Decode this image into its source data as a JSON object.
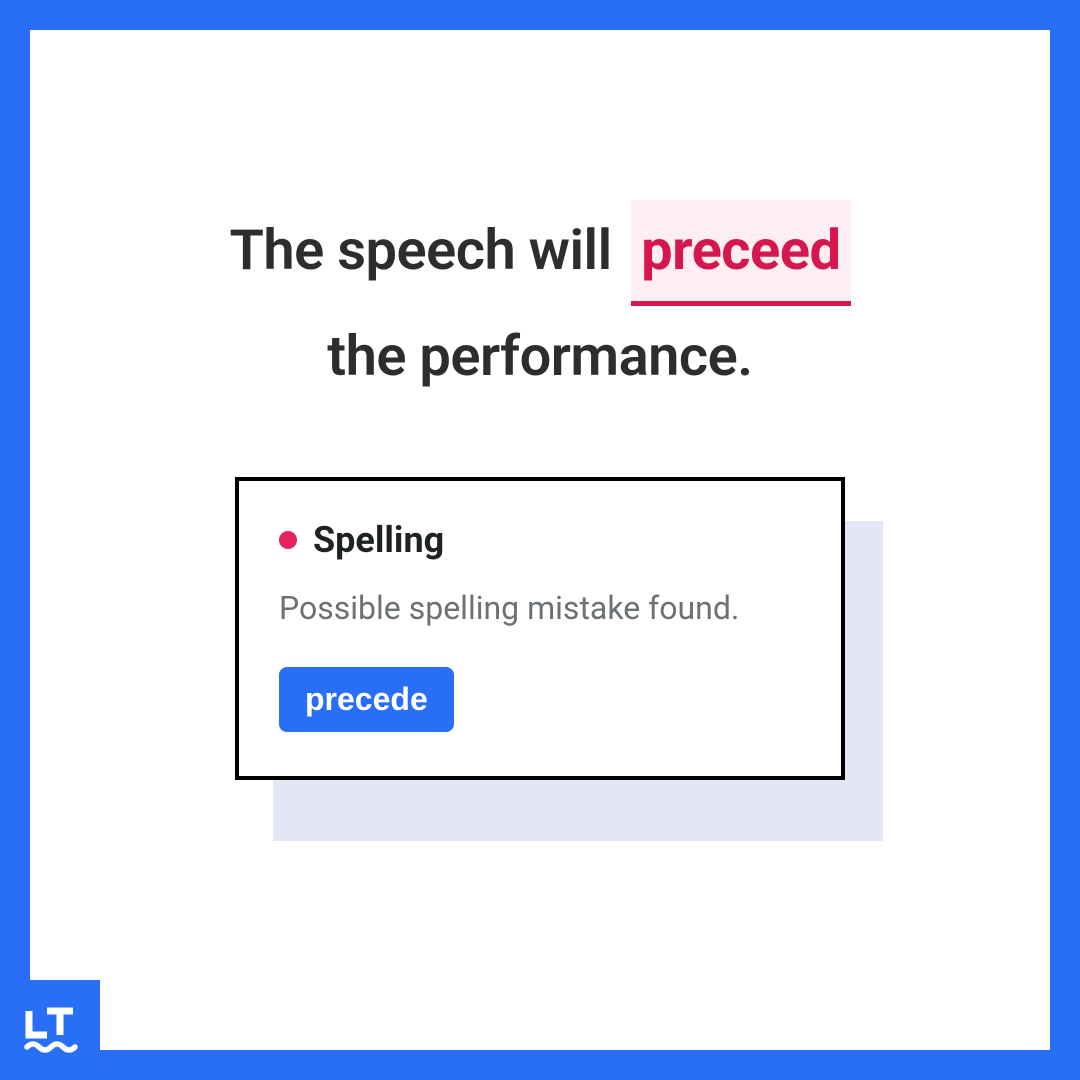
{
  "sentence": {
    "part1": "The speech will",
    "misspelled": "preceed",
    "part2": "the performance."
  },
  "card": {
    "category": "Spelling",
    "description": "Possible spelling mistake found.",
    "suggestion": "precede"
  },
  "colors": {
    "brand": "#296ef6",
    "error": "#d5174e"
  }
}
